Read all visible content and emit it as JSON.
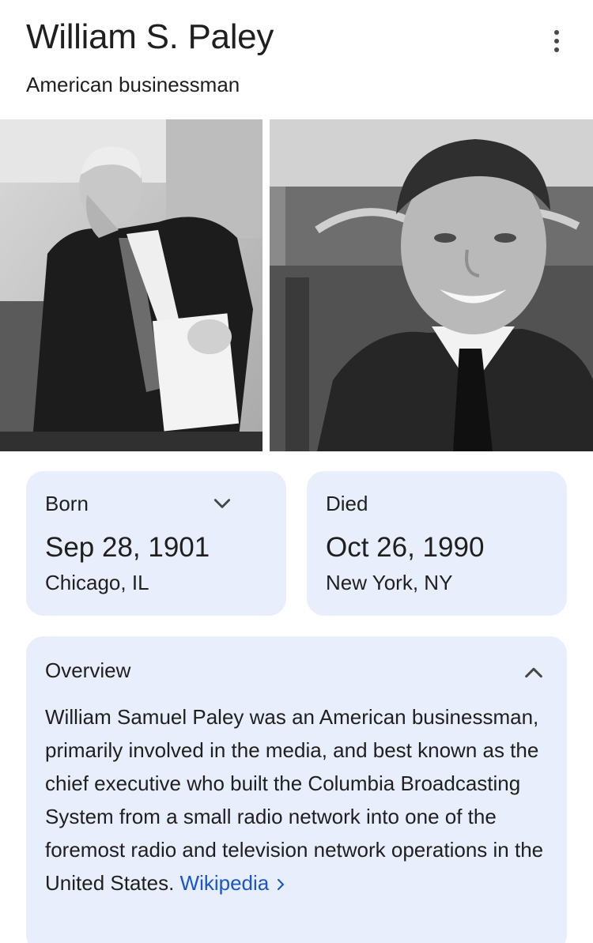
{
  "header": {
    "title": "William S. Paley",
    "subtitle": "American businessman",
    "more_icon": "more-vert-icon"
  },
  "images": [
    {
      "description_icon": "photo-seated-portrait"
    },
    {
      "description_icon": "photo-smiling-portrait"
    }
  ],
  "born": {
    "label": "Born",
    "date": "Sep 28, 1901",
    "place": "Chicago, IL",
    "icon": "chevron-down-icon"
  },
  "died": {
    "label": "Died",
    "date": "Oct 26, 1990",
    "place": "New York, NY"
  },
  "overview": {
    "title": "Overview",
    "text": "William Samuel Paley was an American businessman, primarily involved in the media, and best known as the chief executive who built the Columbia Broadcasting System from a small radio network into one of the foremost radio and television network operations in the United States.",
    "link_label": "Wikipedia",
    "icon": "chevron-up-icon"
  },
  "colors": {
    "card_background": "#e8eefb",
    "link": "#1a56c7",
    "text": "#1f1f1f"
  }
}
